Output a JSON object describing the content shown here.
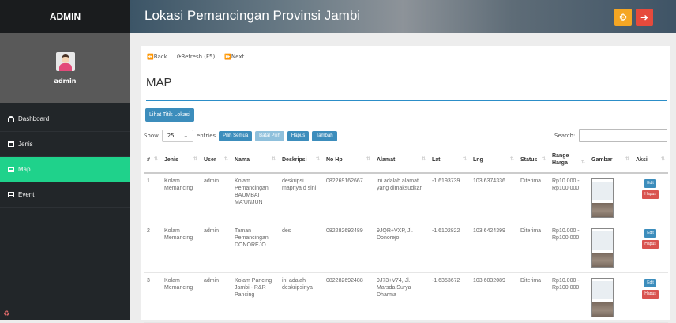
{
  "sidebar": {
    "brand": "ADMIN",
    "username": "admin",
    "items": [
      {
        "label": "Dashboard",
        "icon": "dashboard-icon"
      },
      {
        "label": "Jenis",
        "icon": "table-icon"
      },
      {
        "label": "Map",
        "icon": "table-icon",
        "active": true
      },
      {
        "label": "Event",
        "icon": "table-icon"
      }
    ]
  },
  "header": {
    "title": "Lokasi Pemancingan Provinsi Jambi"
  },
  "toolbar": {
    "back": "Back",
    "refresh": "Refresh (F5)",
    "next": "Next"
  },
  "page": {
    "title": "MAP"
  },
  "actions": {
    "lihat": "Lihat Titik Lokasi",
    "pilih_semua": "Pilih Semua",
    "batal_pilih": "Batal Pilih",
    "hapus": "Hapus",
    "tambah": "Tambah"
  },
  "controls": {
    "show": "Show",
    "entries_value": "25",
    "entries": "entries",
    "search_label": "Search:"
  },
  "table": {
    "headers": [
      "#",
      "Jenis",
      "User",
      "Nama",
      "Deskripsi",
      "No Hp",
      "Alamat",
      "Lat",
      "Lng",
      "Status",
      "Range Harga",
      "Gambar",
      "Aksi"
    ],
    "rows": [
      {
        "no": "1",
        "jenis": "Kolam Memancing",
        "user": "admin",
        "nama": "Kolam Pemancingan BAUMBAI MA'UNJUN",
        "deskripsi": "deskripsi mapnya d sini",
        "nohp": "082269162667",
        "alamat": "ini adalah alamat yang dimaksudkan",
        "lat": "-1.6193739",
        "lng": "103.6374336",
        "status": "Diterima",
        "harga": "Rp10.000 - Rp100.000"
      },
      {
        "no": "2",
        "jenis": "Kolam Memancing",
        "user": "admin",
        "nama": "Taman Pemancingan DONOREJO",
        "deskripsi": "des",
        "nohp": "082282692489",
        "alamat": "9JQR+VXP, Jl. Donorejo",
        "lat": "-1.6102822",
        "lng": "103.6424399",
        "status": "Diterima",
        "harga": "Rp10.000 - Rp100.000"
      },
      {
        "no": "3",
        "jenis": "Kolam Memancing",
        "user": "admin",
        "nama": "Kolam Pancing Jambi - R&R Pancing",
        "deskripsi": "ini adalah deskripsinya",
        "nohp": "082282692488",
        "alamat": "9J73+V74, Jl. Marsda Surya Dharma",
        "lat": "-1.6353672",
        "lng": "103.6032089",
        "status": "Diterima",
        "harga": "Rp10.000 - Rp100.000"
      }
    ],
    "edit_label": "Edit",
    "hapus_label": "Hapus"
  }
}
